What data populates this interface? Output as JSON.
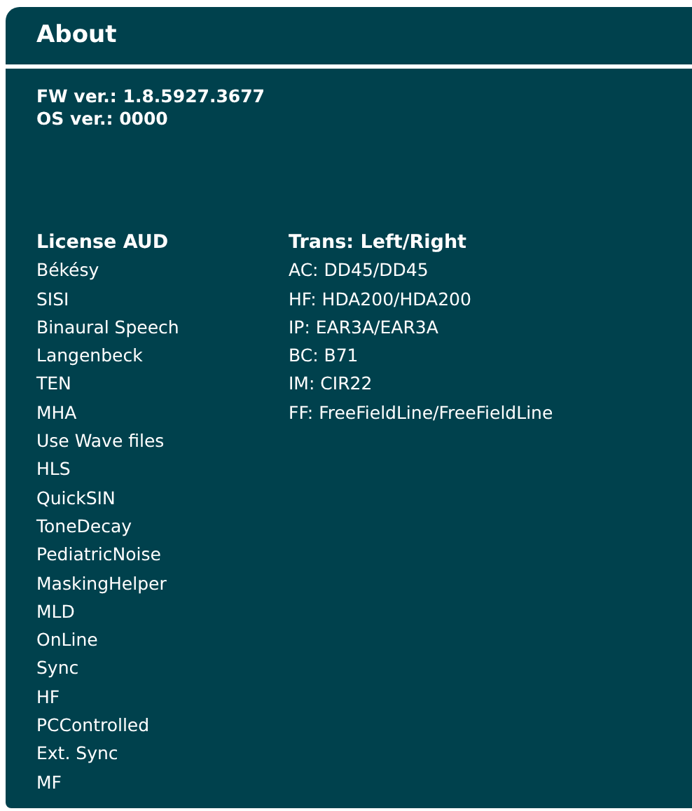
{
  "header": {
    "title": "About"
  },
  "versions": [
    "FW ver.: 1.8.5927.3677",
    "OS ver.: 0000"
  ],
  "licenses": {
    "heading": "License AUD",
    "items": [
      "Békésy",
      "SISI",
      "Binaural Speech",
      "Langenbeck",
      "TEN",
      "MHA",
      "Use Wave files",
      "HLS",
      "QuickSIN",
      "ToneDecay",
      "PediatricNoise",
      "MaskingHelper",
      "MLD",
      "OnLine",
      "Sync",
      "HF",
      "PCControlled",
      "Ext. Sync",
      "MF"
    ]
  },
  "transducers": {
    "heading": "Trans: Left/Right",
    "items": [
      "AC: DD45/DD45",
      "HF: HDA200/HDA200",
      "IP: EAR3A/EAR3A",
      "BC: B71",
      "IM: CIR22",
      "FF: FreeFieldLine/FreeFieldLine"
    ]
  }
}
